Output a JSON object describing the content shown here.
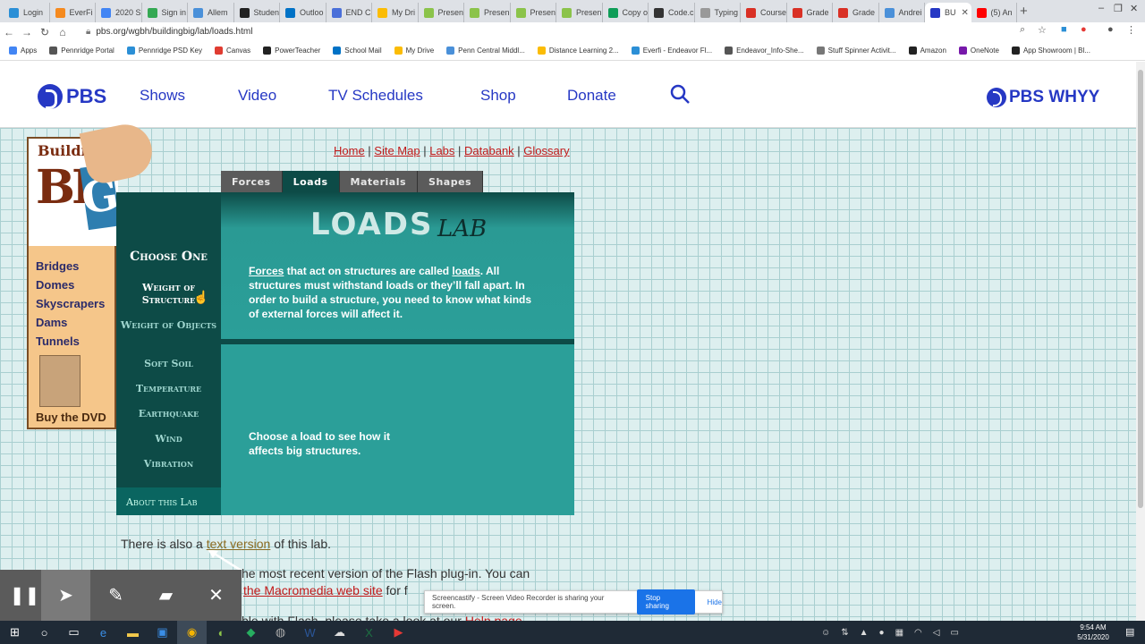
{
  "tabs": [
    {
      "title": "Login",
      "color": "#2b8fd6"
    },
    {
      "title": "EverFi",
      "color": "#f58a1f"
    },
    {
      "title": "2020 S",
      "color": "#4285f4"
    },
    {
      "title": "Sign in",
      "color": "#34a853"
    },
    {
      "title": "Allem",
      "color": "#4a90d9"
    },
    {
      "title": "Studen",
      "color": "#222222"
    },
    {
      "title": "Outloo",
      "color": "#0072c6"
    },
    {
      "title": "END C",
      "color": "#4a6fd9"
    },
    {
      "title": "My Dri",
      "color": "#fbbc05"
    },
    {
      "title": "Presen",
      "color": "#8bc34a"
    },
    {
      "title": "Presen",
      "color": "#8bc34a"
    },
    {
      "title": "Presen",
      "color": "#8bc34a"
    },
    {
      "title": "Presen",
      "color": "#8bc34a"
    },
    {
      "title": "Copy o",
      "color": "#0f9d58"
    },
    {
      "title": "Code.c",
      "color": "#333333"
    },
    {
      "title": "Typing",
      "color": "#999999"
    },
    {
      "title": "Course",
      "color": "#d93025"
    },
    {
      "title": "Grade",
      "color": "#d93025"
    },
    {
      "title": "Grade",
      "color": "#d93025"
    },
    {
      "title": "Andrei",
      "color": "#4a90d9"
    },
    {
      "title": "BU",
      "color": "#2638c4"
    },
    {
      "title": "(5) An",
      "color": "#ff0000"
    }
  ],
  "active_tab_index": 20,
  "window_controls": {
    "minimize": "–",
    "maximize": "❐",
    "close": "✕"
  },
  "toolbar": {
    "url": "pbs.org/wgbh/buildingbig/lab/loads.html"
  },
  "bookmarks": [
    {
      "label": "Apps",
      "color": "#4285f4"
    },
    {
      "label": "Pennridge Portal",
      "color": "#555555"
    },
    {
      "label": "Pennridge PSD Key",
      "color": "#2b8fd6"
    },
    {
      "label": "Canvas",
      "color": "#e03c31"
    },
    {
      "label": "PowerTeacher",
      "color": "#222222"
    },
    {
      "label": "School Mail",
      "color": "#0072c6"
    },
    {
      "label": "My Drive",
      "color": "#fbbc05"
    },
    {
      "label": "Penn Central Middl...",
      "color": "#4a90d9"
    },
    {
      "label": "Distance Learning 2...",
      "color": "#fbbc05"
    },
    {
      "label": "Everfi - Endeavor Fl...",
      "color": "#2b8fd6"
    },
    {
      "label": "Endeavor_Info-She...",
      "color": "#555555"
    },
    {
      "label": "Stuff Spinner Activit...",
      "color": "#777777"
    },
    {
      "label": "Amazon",
      "color": "#222222"
    },
    {
      "label": "OneNote",
      "color": "#7719aa"
    },
    {
      "label": "App Showroom | Bl...",
      "color": "#222222"
    }
  ],
  "pbs_header": {
    "logo": "PBS",
    "nav": [
      "Shows",
      "Video",
      "TV Schedules",
      "Shop",
      "Donate"
    ],
    "station": "PBS WHYY"
  },
  "top_nav": [
    "Home",
    "Site Map",
    "Labs",
    "Databank",
    "Glossary"
  ],
  "building_big": {
    "title": "Building",
    "big": "BI",
    "g": "G",
    "menu": [
      "Bridges",
      "Domes",
      "Skyscrapers",
      "Dams",
      "Tunnels"
    ],
    "dvd": "Buy the DVD"
  },
  "lab": {
    "tabs": [
      "Forces",
      "Loads",
      "Materials",
      "Shapes"
    ],
    "selected_tab": "Loads",
    "title": "LOADS",
    "subtitle": "LAB",
    "choose": "Choose One",
    "loads": [
      "Weight of Structure",
      "Weight of Objects",
      "Soft Soil",
      "Temperature",
      "Earthquake",
      "Wind",
      "Vibration"
    ],
    "about": "About this Lab",
    "intro_forces": "Forces",
    "intro_part1": " that act on structures are called ",
    "intro_loads": "loads",
    "intro_part2": ". All structures must withstand loads or they’ll fall apart. In order to build a structure, you need to know what kinds of external forces will affect it.",
    "hint": "Choose a load to see how it affects big structures."
  },
  "below": {
    "line1_prefix": "There is also a ",
    "line1_link": "text version",
    "line1_suffix": " of this lab.",
    "line2_prefix": "he most recent version of the Flash plug-in. You can",
    "line2_link": "the Macromedia web site",
    "line2_suffix": " for f",
    "line3_prefix": "ble with Flash, please take a look at our ",
    "line3_link": "Help page"
  },
  "screencastify": {
    "message": "Screencastify - Screen Video Recorder is sharing your screen.",
    "stop": "Stop sharing",
    "hide": "Hide"
  },
  "clock": {
    "time": "9:54 AM",
    "date": "5/31/2020"
  }
}
